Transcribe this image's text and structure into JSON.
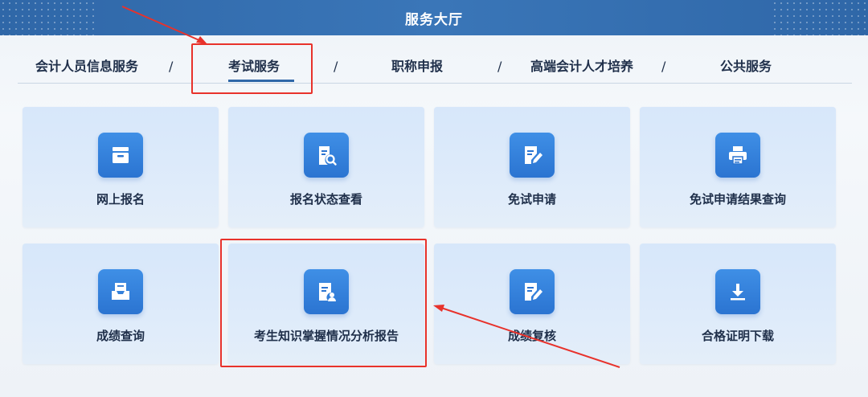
{
  "header": {
    "title": "服务大厅"
  },
  "nav": {
    "items": [
      {
        "label": "会计人员信息服务"
      },
      {
        "label": "考试服务",
        "active": true
      },
      {
        "label": "职称申报"
      },
      {
        "label": "高端会计人才培养"
      },
      {
        "label": "公共服务"
      }
    ],
    "separator": "/"
  },
  "cards": [
    {
      "label": "网上报名",
      "icon": "archive-drawer-icon"
    },
    {
      "label": "报名状态查看",
      "icon": "document-search-icon"
    },
    {
      "label": "免试申请",
      "icon": "document-edit-icon"
    },
    {
      "label": "免试申请结果查询",
      "icon": "printer-icon"
    },
    {
      "label": "成绩查询",
      "icon": "inbox-tray-icon"
    },
    {
      "label": "考生知识掌握情况分析报告",
      "icon": "document-user-icon"
    },
    {
      "label": "成绩复核",
      "icon": "document-edit-icon"
    },
    {
      "label": "合格证明下载",
      "icon": "download-icon"
    }
  ],
  "colors": {
    "accent": "#2f67a8",
    "annotation": "#e8322b",
    "icon_bg": "#2b74d1"
  }
}
